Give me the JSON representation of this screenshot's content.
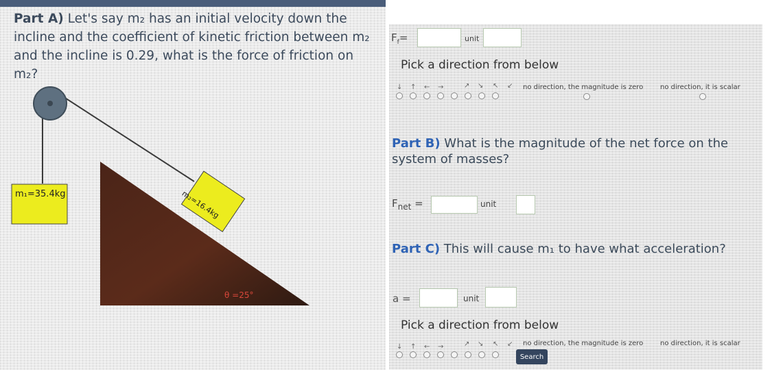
{
  "partA": {
    "label": "Part A)",
    "question": "Let's say m₂ has an initial velocity down the incline and the coefficient of kinetic friction between m₂ and the incline is 0.29, what is the force of friction on m₂?"
  },
  "diagram": {
    "m1_label": "m₁=35.4kg",
    "m2_label": "m₂=16.4kg",
    "angle_label": "θ =25°"
  },
  "answerA": {
    "ff_label": "F",
    "ff_sub": "f",
    "ff_eq": "=",
    "unit_label": "unit",
    "direction_prompt": "Pick a direction from below",
    "arrows": [
      "↓",
      "↑",
      "←",
      "→",
      "↗",
      "↘",
      "↖",
      "↙"
    ],
    "no_direction_zero": "no direction, the magnitude is zero",
    "no_direction_scalar": "no direction, it is scalar"
  },
  "partB": {
    "label": "Part B)",
    "question": "What is the magnitude of the net force on the system of masses?",
    "fnet_label": "F",
    "fnet_sub": "net",
    "fnet_eq": "=",
    "unit_label": "unit"
  },
  "partC": {
    "label": "Part C)",
    "question": "This will cause m₁ to have what acceleration?",
    "a_label": "a =",
    "unit_label": "unit",
    "direction_prompt": "Pick a direction from below",
    "arrows": [
      "↓",
      "↑",
      "←",
      "→",
      "↗",
      "↘",
      "↖",
      "↙"
    ],
    "no_direction_zero": "no direction, the magnitude is zero",
    "no_direction_scalar": "no direction, it is scalar",
    "search_label": "Search"
  },
  "colors": {
    "heading_blue": "#2f63b5",
    "incline_dark": "#3d2418",
    "incline_light": "#7a3b22",
    "box_yellow": "#ecec1e",
    "angle_red": "#d9473a"
  }
}
